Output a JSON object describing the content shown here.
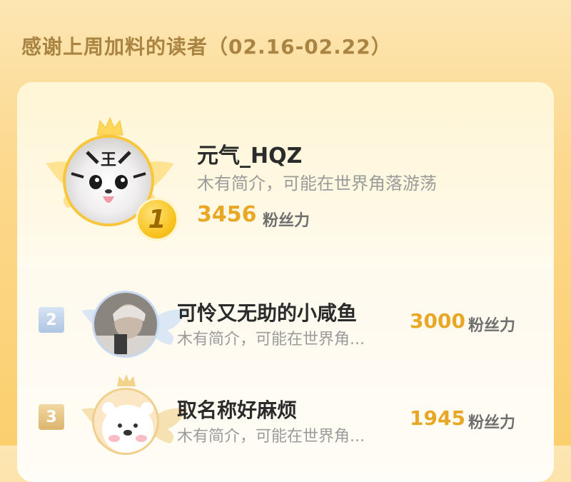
{
  "header": {
    "title": "感谢上周加料的读者（02.16-02.22）"
  },
  "winner": {
    "rank": "1",
    "name": "元气_HQZ",
    "bio": "木有简介，可能在世界角落游荡",
    "score": "3456",
    "unit": "粉丝力"
  },
  "entries": [
    {
      "rank": "2",
      "name": "可怜又无助的小咸鱼",
      "bio": "木有简介，可能在世界角...",
      "score": "3000",
      "unit": "粉丝力"
    },
    {
      "rank": "3",
      "name": "取名称好麻烦",
      "bio": "木有简介，可能在世界角...",
      "score": "1945",
      "unit": "粉丝力"
    }
  ],
  "colors": {
    "gold": "#e8a826",
    "silver_badge": "#b9cde6",
    "bronze_badge": "#e6c78a"
  },
  "icons": {
    "crown": "crown-icon",
    "wings": "wings-icon",
    "tiger": "tiger-avatar"
  }
}
